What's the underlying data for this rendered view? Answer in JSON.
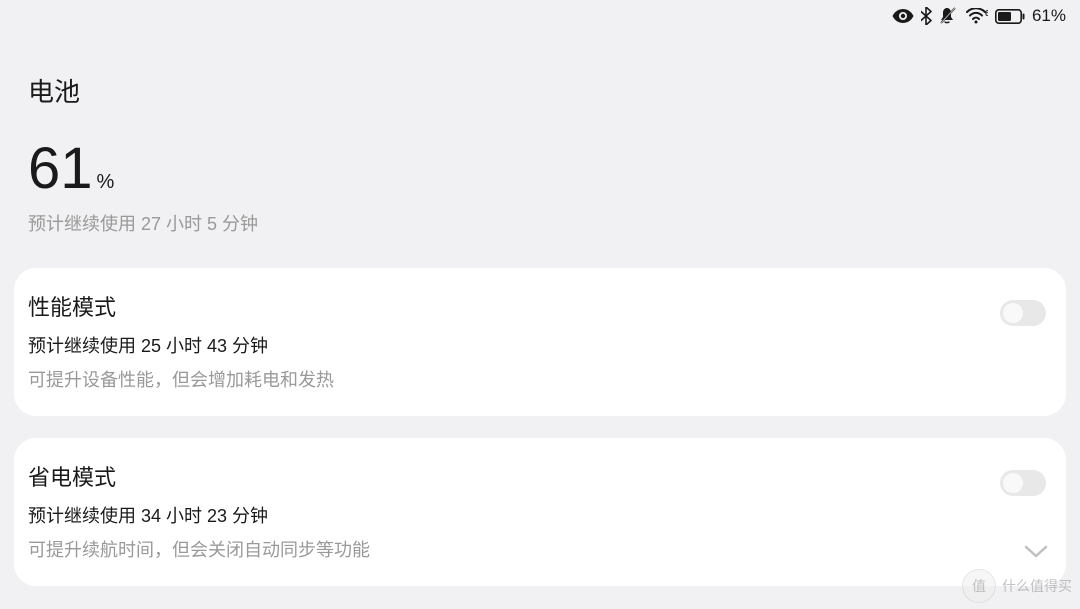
{
  "status": {
    "battery_text": "61%"
  },
  "page": {
    "title": "电池"
  },
  "battery": {
    "percent_number": "61",
    "percent_symbol": "%",
    "estimate": "预计继续使用 27 小时 5 分钟"
  },
  "modes": {
    "performance": {
      "title": "性能模式",
      "subtitle": "预计继续使用 25 小时 43 分钟",
      "description": "可提升设备性能，但会增加耗电和发热"
    },
    "power_saving": {
      "title": "省电模式",
      "subtitle": "预计继续使用 34 小时 23 分钟",
      "description": "可提升续航时间，但会关闭自动同步等功能"
    }
  },
  "watermark": {
    "circle": "值",
    "text": "什么值得买"
  }
}
